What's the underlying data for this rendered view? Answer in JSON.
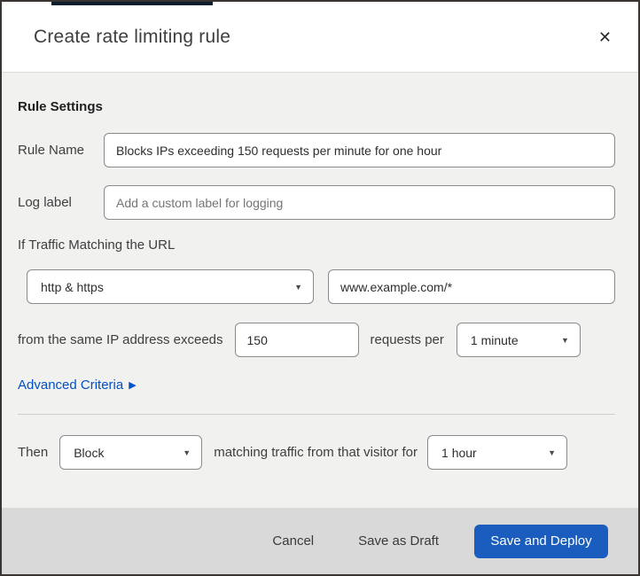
{
  "modal": {
    "title": "Create rate limiting rule",
    "close_icon": "✕"
  },
  "rule_settings": {
    "heading": "Rule Settings",
    "rule_name": {
      "label": "Rule Name",
      "value": "Blocks IPs exceeding 150 requests per minute for one hour"
    },
    "log_label": {
      "label": "Log label",
      "placeholder": "Add a custom label for logging"
    }
  },
  "traffic_match": {
    "intro": "If Traffic Matching the URL",
    "scheme_dropdown": {
      "selected": "http & https",
      "caret": "▼"
    },
    "url_input": {
      "value": "www.example.com/*"
    },
    "exceeds_text": "from the same IP address exceeds",
    "requests_input": {
      "value": "150"
    },
    "requests_per_text": "requests per",
    "period_dropdown": {
      "selected": "1 minute",
      "caret": "▼"
    },
    "advanced_link": {
      "label": "Advanced Criteria",
      "arrow": "▶"
    }
  },
  "then_section": {
    "then_label": "Then",
    "action_dropdown": {
      "selected": "Block",
      "caret": "▼"
    },
    "middle_text": "matching traffic from that visitor for",
    "duration_dropdown": {
      "selected": "1 hour",
      "caret": "▼"
    }
  },
  "footer": {
    "cancel_label": "Cancel",
    "save_draft_label": "Save as Draft",
    "save_deploy_label": "Save and Deploy"
  },
  "colors": {
    "primary_button": "#1a5dbe",
    "link_blue": "#0050c8",
    "body_bg": "#f1f1f0",
    "footer_bg": "#d9d9d9",
    "top_sliver": "#0c1e2e"
  }
}
